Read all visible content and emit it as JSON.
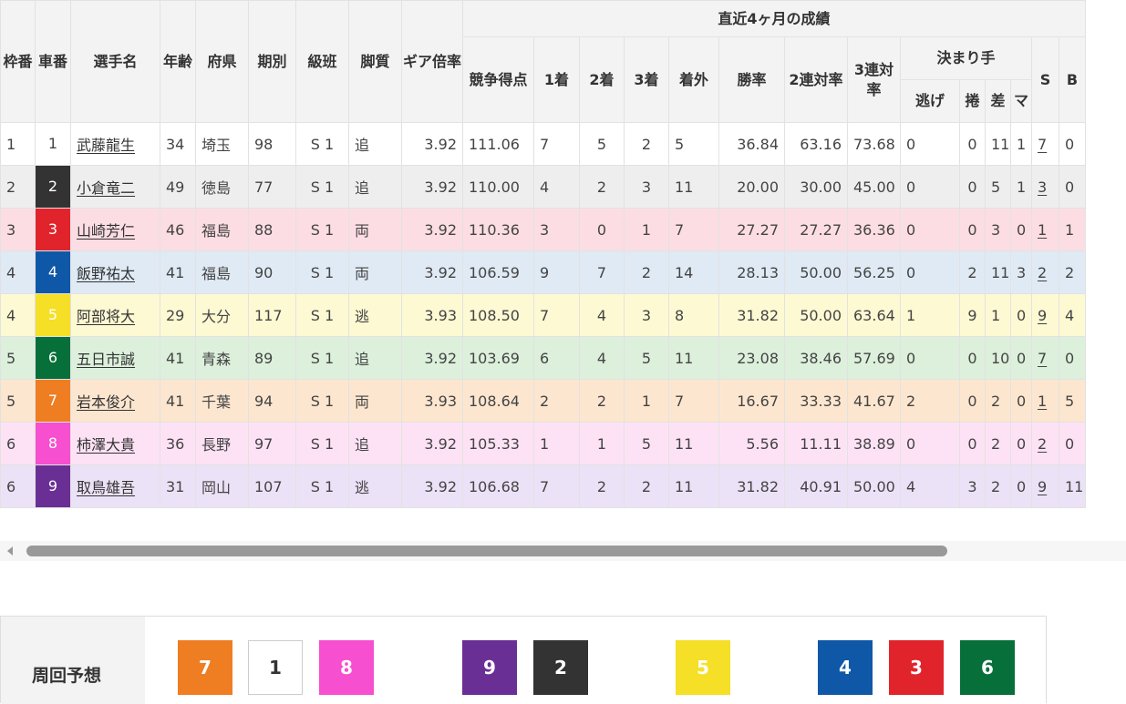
{
  "headers": {
    "waku": "枠番",
    "sha": "車番",
    "name": "選手名",
    "age": "年齢",
    "pref": "府県",
    "term": "期別",
    "class": "級班",
    "style": "脚質",
    "gear": "ギア倍率",
    "recent": "直近4ヶ月の成績",
    "score": "競争得点",
    "first": "1着",
    "second": "2着",
    "third": "3着",
    "out": "着外",
    "win": "勝率",
    "ren2": "2連対率",
    "ren3": "3連対率",
    "kimarite": "決まり手",
    "nige": "逃げ",
    "makuri": "捲",
    "sashi": "差",
    "ma": "マ",
    "s": "S",
    "b": "B"
  },
  "rows": [
    {
      "waku": "1",
      "sha": "1",
      "name": "武藤龍生",
      "age": "34",
      "pref": "埼玉",
      "term": "98",
      "class": "S 1",
      "style": "追",
      "gear": "3.92",
      "score": "111.06",
      "c1": "7",
      "c2": "5",
      "c3": "2",
      "out": "5",
      "win": "36.84",
      "ren2": "63.16",
      "ren3": "73.68",
      "nige": "0",
      "makuri": "0",
      "sashi": "11",
      "ma": "1",
      "s": "7",
      "b": "0",
      "bg": "#ffffff",
      "sha_bg": "#ffffff",
      "sha_fg": "#444444"
    },
    {
      "waku": "2",
      "sha": "2",
      "name": "小倉竜二",
      "age": "49",
      "pref": "徳島",
      "term": "77",
      "class": "S 1",
      "style": "追",
      "gear": "3.92",
      "score": "110.00",
      "c1": "4",
      "c2": "2",
      "c3": "3",
      "out": "11",
      "win": "20.00",
      "ren2": "30.00",
      "ren3": "45.00",
      "nige": "0",
      "makuri": "0",
      "sashi": "5",
      "ma": "1",
      "s": "3",
      "b": "0",
      "bg": "#eeeeee",
      "sha_bg": "#333333",
      "sha_fg": "#ffffff"
    },
    {
      "waku": "3",
      "sha": "3",
      "name": "山崎芳仁",
      "age": "46",
      "pref": "福島",
      "term": "88",
      "class": "S 1",
      "style": "両",
      "gear": "3.92",
      "score": "110.36",
      "c1": "3",
      "c2": "0",
      "c3": "1",
      "out": "7",
      "win": "27.27",
      "ren2": "27.27",
      "ren3": "36.36",
      "nige": "0",
      "makuri": "0",
      "sashi": "3",
      "ma": "0",
      "s": "1",
      "b": "1",
      "bg": "#fcdde3",
      "sha_bg": "#e1242c",
      "sha_fg": "#ffffff"
    },
    {
      "waku": "4",
      "sha": "4",
      "name": "飯野祐太",
      "age": "41",
      "pref": "福島",
      "term": "90",
      "class": "S 1",
      "style": "両",
      "gear": "3.92",
      "score": "106.59",
      "c1": "9",
      "c2": "7",
      "c3": "2",
      "out": "14",
      "win": "28.13",
      "ren2": "50.00",
      "ren3": "56.25",
      "nige": "0",
      "makuri": "2",
      "sashi": "11",
      "ma": "3",
      "s": "2",
      "b": "2",
      "bg": "#dfeaf5",
      "sha_bg": "#0f58a8",
      "sha_fg": "#ffffff"
    },
    {
      "waku": "4",
      "sha": "5",
      "name": "阿部将大",
      "age": "29",
      "pref": "大分",
      "term": "117",
      "class": "S 1",
      "style": "逃",
      "gear": "3.93",
      "score": "108.50",
      "c1": "7",
      "c2": "4",
      "c3": "3",
      "out": "8",
      "win": "31.82",
      "ren2": "50.00",
      "ren3": "63.64",
      "nige": "1",
      "makuri": "9",
      "sashi": "1",
      "ma": "0",
      "s": "9",
      "b": "4",
      "bg": "#fdf9d3",
      "sha_bg": "#f5df27",
      "sha_fg": "#ffffff"
    },
    {
      "waku": "5",
      "sha": "6",
      "name": "五日市誠",
      "age": "41",
      "pref": "青森",
      "term": "89",
      "class": "S 1",
      "style": "追",
      "gear": "3.92",
      "score": "103.69",
      "c1": "6",
      "c2": "4",
      "c3": "5",
      "out": "11",
      "win": "23.08",
      "ren2": "38.46",
      "ren3": "57.69",
      "nige": "0",
      "makuri": "0",
      "sashi": "10",
      "ma": "0",
      "s": "7",
      "b": "0",
      "bg": "#dcf0dc",
      "sha_bg": "#07703a",
      "sha_fg": "#ffffff"
    },
    {
      "waku": "5",
      "sha": "7",
      "name": "岩本俊介",
      "age": "41",
      "pref": "千葉",
      "term": "94",
      "class": "S 1",
      "style": "両",
      "gear": "3.93",
      "score": "108.64",
      "c1": "2",
      "c2": "2",
      "c3": "1",
      "out": "7",
      "win": "16.67",
      "ren2": "33.33",
      "ren3": "41.67",
      "nige": "2",
      "makuri": "0",
      "sashi": "2",
      "ma": "0",
      "s": "1",
      "b": "5",
      "bg": "#fde6cf",
      "sha_bg": "#ef7d22",
      "sha_fg": "#ffffff"
    },
    {
      "waku": "6",
      "sha": "8",
      "name": "柿澤大貴",
      "age": "36",
      "pref": "長野",
      "term": "97",
      "class": "S 1",
      "style": "追",
      "gear": "3.92",
      "score": "105.33",
      "c1": "1",
      "c2": "1",
      "c3": "5",
      "out": "11",
      "win": "5.56",
      "ren2": "11.11",
      "ren3": "38.89",
      "nige": "0",
      "makuri": "0",
      "sashi": "2",
      "ma": "0",
      "s": "2",
      "b": "0",
      "bg": "#fde2f5",
      "sha_bg": "#f64fcf",
      "sha_fg": "#ffffff"
    },
    {
      "waku": "6",
      "sha": "9",
      "name": "取鳥雄吾",
      "age": "31",
      "pref": "岡山",
      "term": "107",
      "class": "S 1",
      "style": "逃",
      "gear": "3.92",
      "score": "106.68",
      "c1": "7",
      "c2": "2",
      "c3": "2",
      "out": "11",
      "win": "31.82",
      "ren2": "40.91",
      "ren3": "50.00",
      "nige": "4",
      "makuri": "3",
      "sashi": "2",
      "ma": "0",
      "s": "9",
      "b": "11",
      "bg": "#ece2f7",
      "sha_bg": "#6a2f95",
      "sha_fg": "#ffffff"
    }
  ],
  "prediction": {
    "label": "周回予想",
    "boxes": [
      {
        "num": "7",
        "bg": "#ef7d22",
        "fg": "#ffffff"
      },
      {
        "num": "1",
        "bg": "#ffffff",
        "fg": "#333333"
      },
      {
        "num": "8",
        "bg": "#f64fcf",
        "fg": "#ffffff"
      },
      {
        "num": "9",
        "bg": "#6a2f95",
        "fg": "#ffffff"
      },
      {
        "num": "2",
        "bg": "#333333",
        "fg": "#ffffff"
      },
      {
        "num": "5",
        "bg": "#f5df27",
        "fg": "#ffffff"
      },
      {
        "num": "4",
        "bg": "#0f58a8",
        "fg": "#ffffff"
      },
      {
        "num": "3",
        "bg": "#e1242c",
        "fg": "#ffffff"
      },
      {
        "num": "6",
        "bg": "#07703a",
        "fg": "#ffffff"
      }
    ]
  }
}
